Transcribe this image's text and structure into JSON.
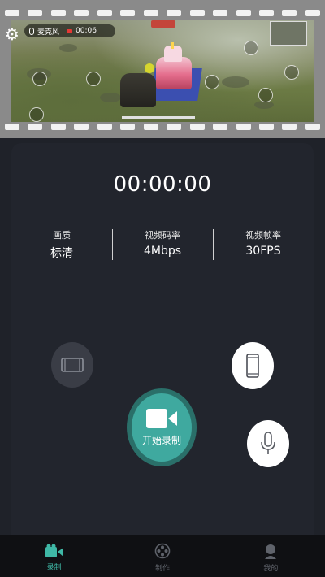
{
  "preview": {
    "mic_label": "麦克风",
    "rec_time": "00:06"
  },
  "recorder": {
    "timer": "00:00:00",
    "stats": [
      {
        "label": "画质",
        "value": "标清"
      },
      {
        "label": "视频码率",
        "value": "4Mbps"
      },
      {
        "label": "视频帧率",
        "value": "30FPS"
      }
    ],
    "start_label": "开始录制"
  },
  "nav": {
    "items": [
      {
        "label": "录制",
        "icon": "camera-icon",
        "active": true
      },
      {
        "label": "制作",
        "icon": "film-reel-icon",
        "active": false
      },
      {
        "label": "我的",
        "icon": "profile-icon",
        "active": false
      }
    ]
  },
  "colors": {
    "accent": "#3fb8a6",
    "record_button": "#3fa99f",
    "panel": "#22252d",
    "nav_bg": "#0f1013"
  }
}
